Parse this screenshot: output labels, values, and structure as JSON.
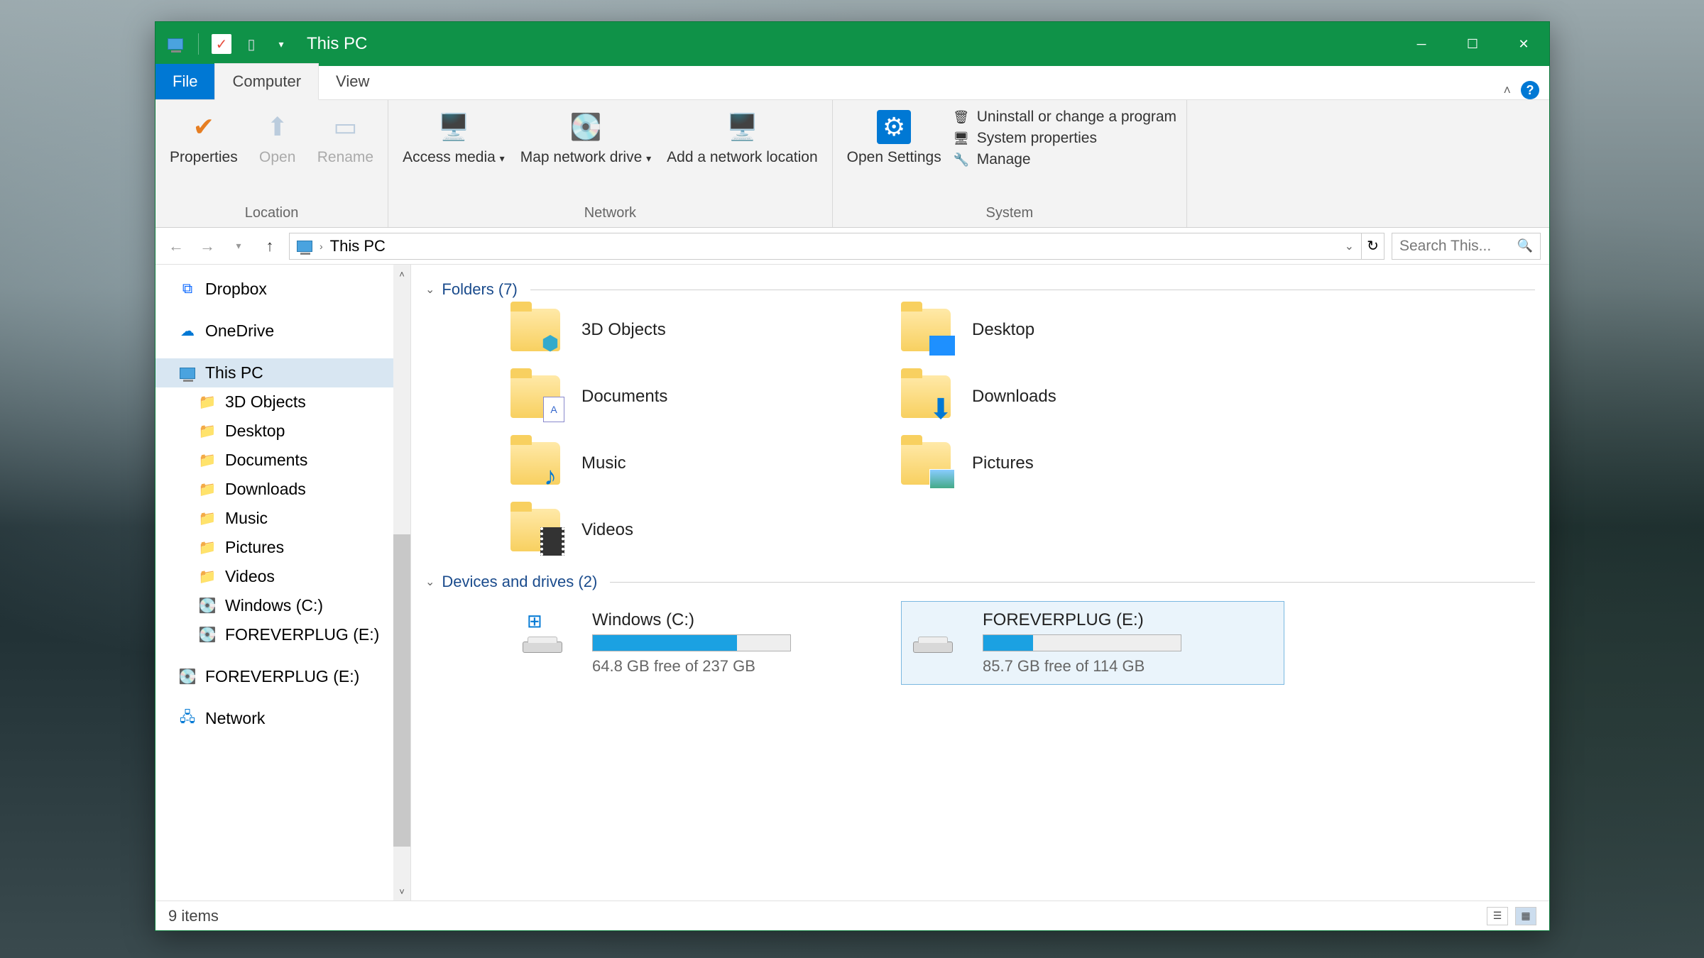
{
  "title": "This PC",
  "tabs": {
    "file": "File",
    "computer": "Computer",
    "view": "View"
  },
  "ribbon": {
    "location": {
      "label": "Location",
      "properties": "Properties",
      "open": "Open",
      "rename": "Rename"
    },
    "network": {
      "label": "Network",
      "access_media": "Access media",
      "map_drive": "Map network drive",
      "add_loc": "Add a network location"
    },
    "system": {
      "label": "System",
      "open_settings": "Open Settings",
      "uninstall": "Uninstall or change a program",
      "sys_props": "System properties",
      "manage": "Manage"
    }
  },
  "address": {
    "location": "This PC"
  },
  "search": {
    "placeholder": "Search This..."
  },
  "sidebar": {
    "dropbox": "Dropbox",
    "onedrive": "OneDrive",
    "this_pc": "This PC",
    "objects3d": "3D Objects",
    "desktop": "Desktop",
    "documents": "Documents",
    "downloads": "Downloads",
    "music": "Music",
    "pictures": "Pictures",
    "videos": "Videos",
    "windows_c": "Windows (C:)",
    "foreverplug_e": "FOREVERPLUG (E:)",
    "foreverplug_e2": "FOREVERPLUG (E:)",
    "network": "Network"
  },
  "sections": {
    "folders": "Folders (7)",
    "drives": "Devices and drives (2)"
  },
  "folders": {
    "objects3d": "3D Objects",
    "desktop": "Desktop",
    "documents": "Documents",
    "downloads": "Downloads",
    "music": "Music",
    "pictures": "Pictures",
    "videos": "Videos"
  },
  "drives": {
    "c": {
      "name": "Windows (C:)",
      "free": "64.8 GB free of 237 GB",
      "fill_pct": 73
    },
    "e": {
      "name": "FOREVERPLUG (E:)",
      "free": "85.7 GB free of 114 GB",
      "fill_pct": 25
    }
  },
  "status": {
    "items": "9 items"
  }
}
